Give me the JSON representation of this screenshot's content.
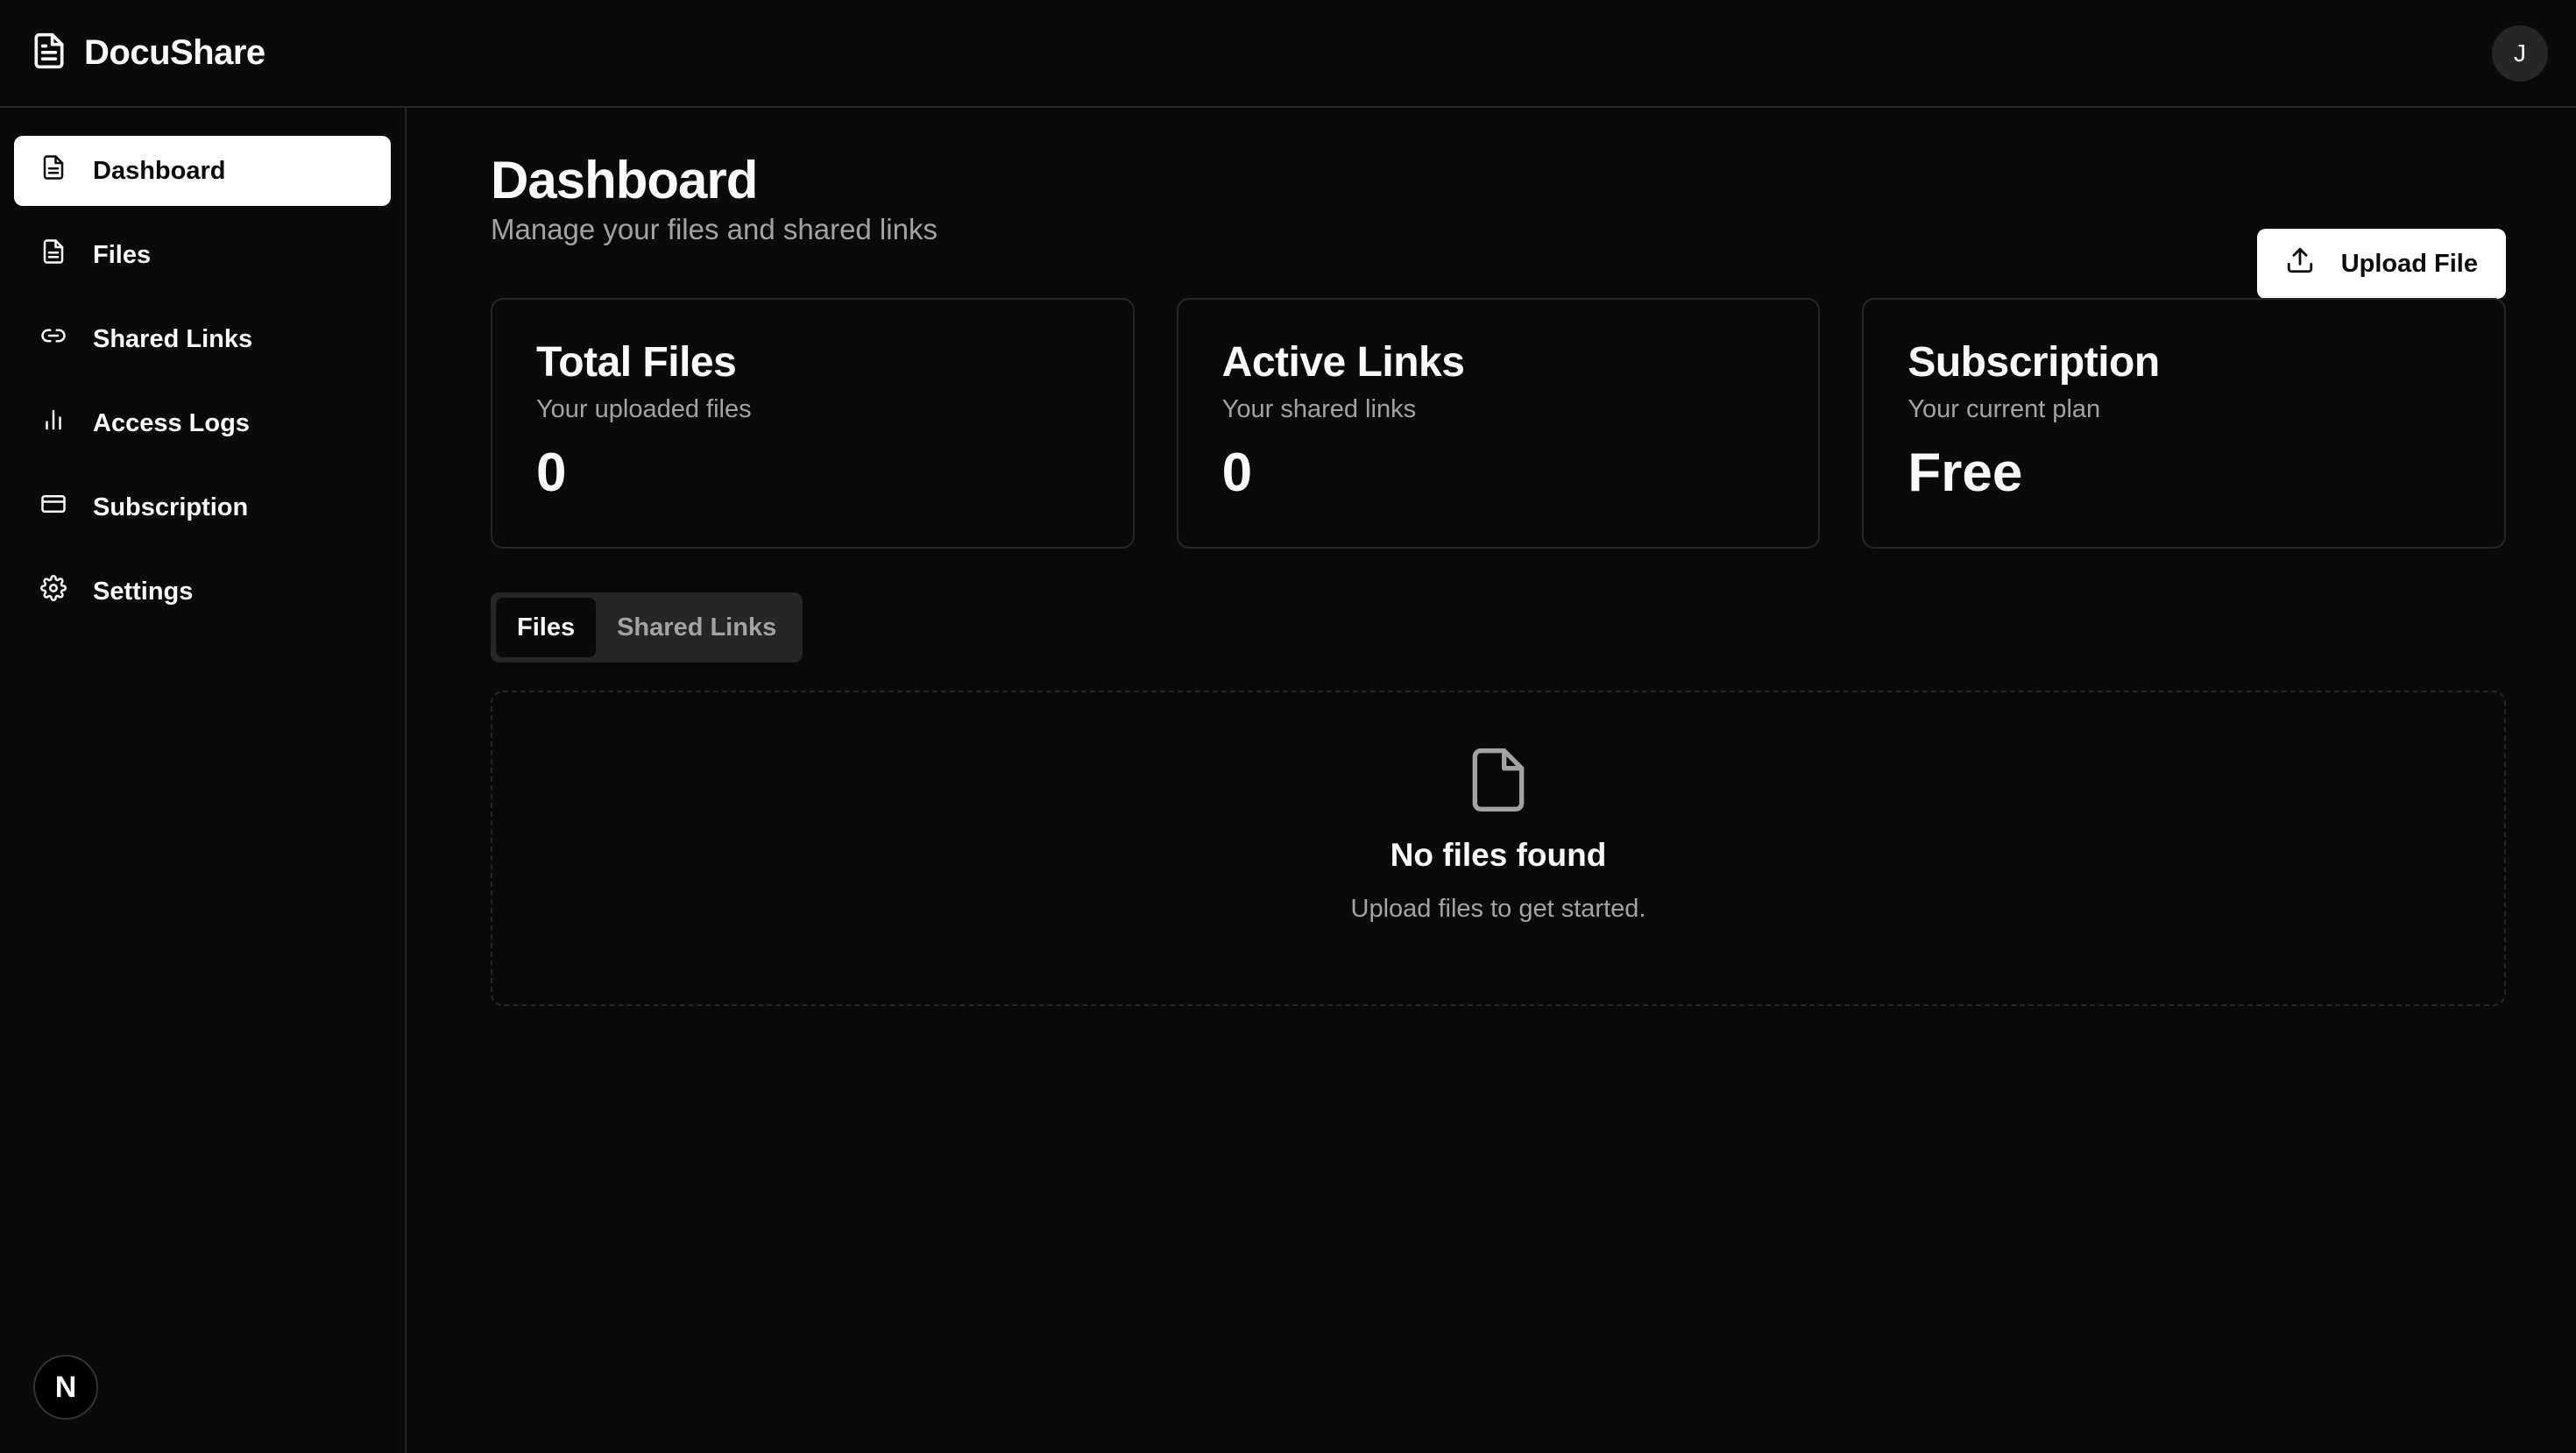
{
  "app": {
    "name": "DocuShare",
    "logo_icon": "file-text-icon",
    "user_initial": "J"
  },
  "sidebar": {
    "items": [
      {
        "label": "Dashboard",
        "icon": "file-text-icon",
        "active": true
      },
      {
        "label": "Files",
        "icon": "file-icon",
        "active": false
      },
      {
        "label": "Shared Links",
        "icon": "link-icon",
        "active": false
      },
      {
        "label": "Access Logs",
        "icon": "bar-chart-icon",
        "active": false
      },
      {
        "label": "Subscription",
        "icon": "credit-card-icon",
        "active": false
      },
      {
        "label": "Settings",
        "icon": "gear-icon",
        "active": false
      }
    ],
    "footer_badge": "N"
  },
  "main": {
    "title": "Dashboard",
    "subtitle": "Manage your files and shared links",
    "upload_label": "Upload File",
    "cards": [
      {
        "title": "Total Files",
        "description": "Your uploaded files",
        "value": "0"
      },
      {
        "title": "Active Links",
        "description": "Your shared links",
        "value": "0"
      },
      {
        "title": "Subscription",
        "description": "Your current plan",
        "value": "Free"
      }
    ],
    "tabs": [
      {
        "label": "Files",
        "active": true
      },
      {
        "label": "Shared Links",
        "active": false
      }
    ],
    "empty_state": {
      "title": "No files found",
      "description": "Upload files to get started."
    }
  },
  "colors": {
    "background": "#0a0a0a",
    "border": "#262626",
    "muted_text": "#a3a3a3",
    "primary": "#ffffff"
  }
}
